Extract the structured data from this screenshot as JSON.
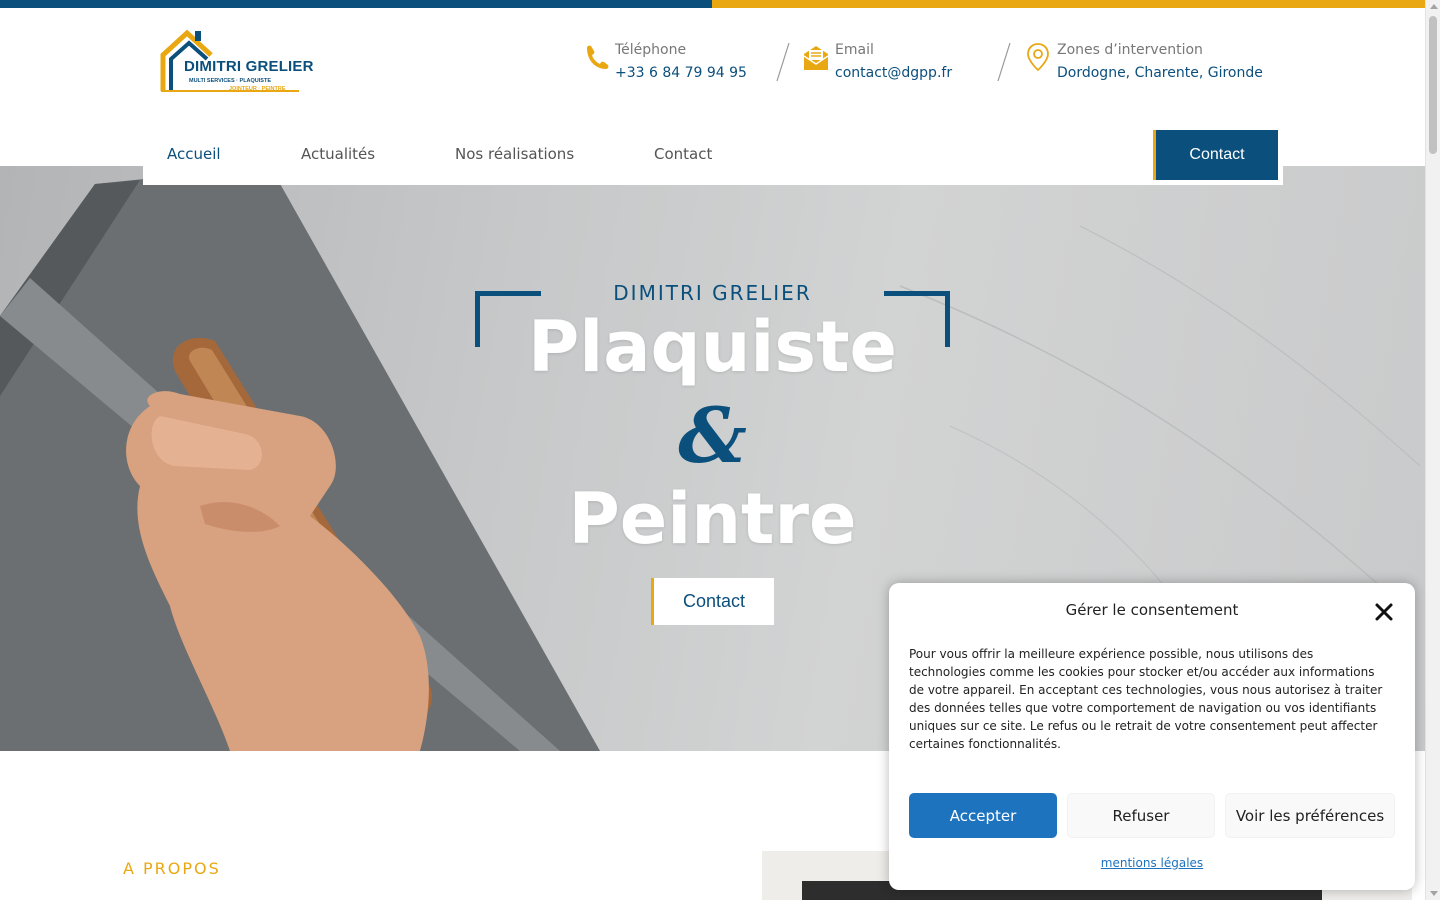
{
  "colors": {
    "brand_blue": "#0b4f7c",
    "brand_gold": "#e9a812",
    "accept_blue": "#1e73be"
  },
  "logo": {
    "name": "DIMITRI GRELIER",
    "subtitle": "MULTI SERVICES · PLAQUISTE",
    "subtitle2": "JOINTEUR · PEINTRE"
  },
  "header": {
    "phone": {
      "icon": "phone-icon",
      "label": "Téléphone",
      "value": "+33 6 84 79 94 95"
    },
    "email": {
      "icon": "envelope-icon",
      "label": "Email",
      "value": "contact@dgpp.fr"
    },
    "zones": {
      "icon": "map-pin-icon",
      "label": "Zones d’intervention",
      "value": "Dordogne, Charente, Gironde"
    }
  },
  "nav": {
    "items": [
      "Accueil",
      "Actualités",
      "Nos réalisations",
      "Contact"
    ],
    "active": "Accueil",
    "cta_label": "Contact"
  },
  "hero": {
    "kicker": "DIMITRI GRELIER",
    "title_line1": "Plaquiste",
    "ampersand": "&",
    "title_line2": "Peintre",
    "button_label": "Contact"
  },
  "about": {
    "kicker": "A PROPOS"
  },
  "consent": {
    "title": "Gérer le consentement",
    "close_icon": "close-icon",
    "text": "Pour vous offrir la meilleure expérience possible, nous utilisons des technologies comme les cookies pour stocker et/ou accéder aux informations de votre appareil. En acceptant ces technologies, vous nous autorisez à traiter des données telles que votre comportement de navigation ou vos identifiants uniques sur ce site. Le refus ou le retrait de votre consentement peut affecter certaines fonctionnalités.",
    "accept_label": "Accepter",
    "refuse_label": "Refuser",
    "prefs_label": "Voir les préférences",
    "legal_label": "mentions légales"
  }
}
